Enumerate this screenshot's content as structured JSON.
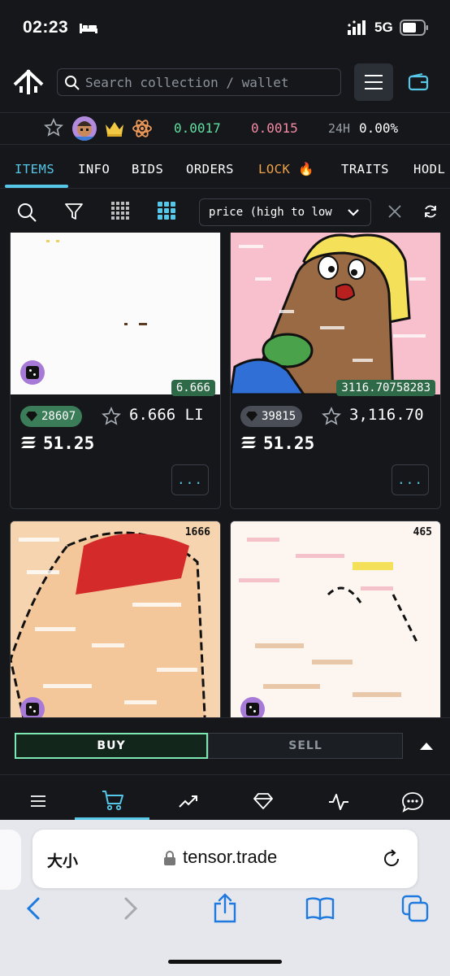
{
  "status_bar": {
    "time": "02:23",
    "network": "5G"
  },
  "header": {
    "search_placeholder": "Search collection / wallet"
  },
  "stats": {
    "floor": "0.0017",
    "best_bid": "0.0015",
    "change_label": "24H",
    "change_value": "0.00%"
  },
  "tabs": [
    {
      "label": "ITEMS",
      "active": true
    },
    {
      "label": "INFO"
    },
    {
      "label": "BIDS"
    },
    {
      "label": "ORDERS"
    },
    {
      "label": "LOCK 🔥"
    },
    {
      "label": "TRAITS"
    },
    {
      "label": "HODL"
    }
  ],
  "toolbar": {
    "sort_value": "price (high to low"
  },
  "cards": [
    {
      "rank_tag": "6.666",
      "rarity": "28607",
      "last_price": "6.666 LI",
      "price": "51.25",
      "more": "...",
      "badge_color": "green"
    },
    {
      "rank_tag": "3116.70758283",
      "rarity": "39815",
      "last_price": "3,116.70",
      "price": "51.25",
      "more": "...",
      "badge_color": "grey"
    },
    {
      "supply": "1666"
    },
    {
      "supply": "465"
    }
  ],
  "trade": {
    "buy_label": "BUY",
    "sell_label": "SELL"
  },
  "safari": {
    "text_size": "大小",
    "url": "tensor.trade"
  },
  "colors": {
    "accent": "#57c7e8",
    "buy_green": "#7ee8b4",
    "floor_green": "#5fe0a0",
    "bid_pink": "#f48aa4"
  },
  "icons": [
    "bed-icon",
    "signal-icon",
    "battery-icon",
    "tensor-logo",
    "search-icon",
    "hamburger-menu-icon",
    "wallet-icon",
    "star-icon",
    "crown-icon",
    "atom-icon",
    "filter-icon",
    "grid-small-icon",
    "grid-large-icon",
    "chevron-down-icon",
    "close-icon",
    "refresh-icon",
    "gem-icon",
    "sol-icon",
    "dice-icon",
    "caret-up-icon",
    "list-icon",
    "cart-icon",
    "chart-icon",
    "diamond-icon",
    "activity-icon",
    "chat-icon",
    "lock-icon",
    "reload-icon",
    "back-icon",
    "forward-icon",
    "share-icon",
    "bookmarks-icon",
    "tabs-icon"
  ]
}
